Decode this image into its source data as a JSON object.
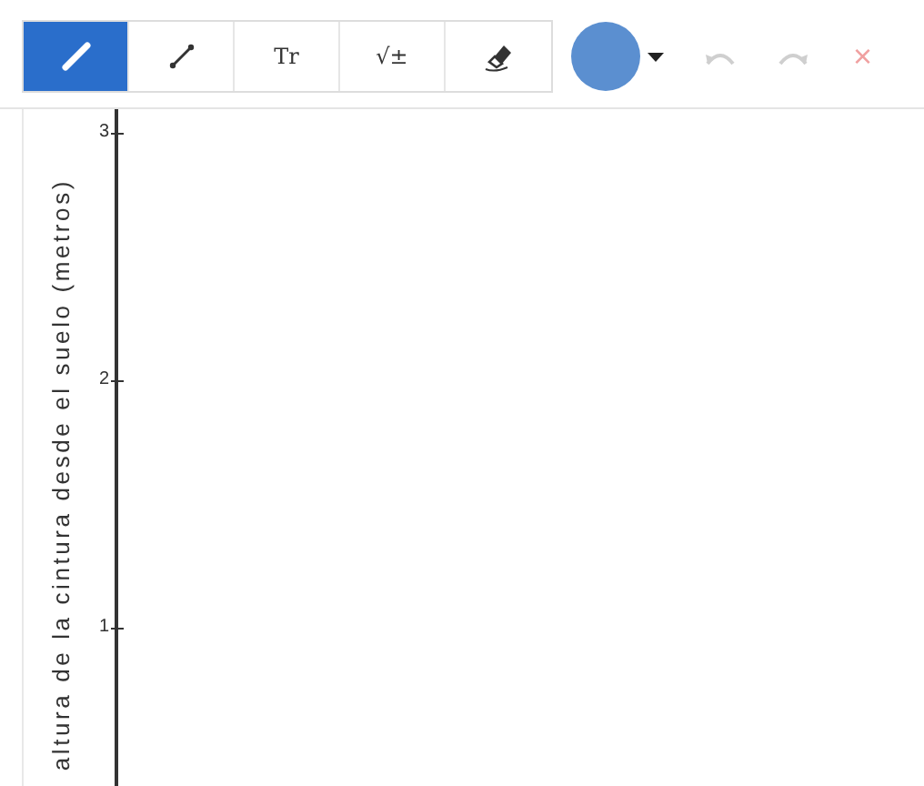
{
  "toolbar": {
    "tools": [
      {
        "kind": "pen",
        "selected": true
      },
      {
        "kind": "line",
        "selected": false
      },
      {
        "kind": "text",
        "label": "Tr",
        "selected": false
      },
      {
        "kind": "math",
        "label": "√±",
        "selected": false
      },
      {
        "kind": "eraser",
        "selected": false
      }
    ],
    "color": {
      "color": "#5b8fd0"
    },
    "undo": {
      "disabled": true
    },
    "redo": {
      "disabled": true
    },
    "close": {
      "label": "×"
    }
  },
  "graph": {
    "y_axis": {
      "label": "altura de la cintura desde el suelo (metros)",
      "ticks": [
        "3",
        "2",
        "1"
      ]
    }
  }
}
